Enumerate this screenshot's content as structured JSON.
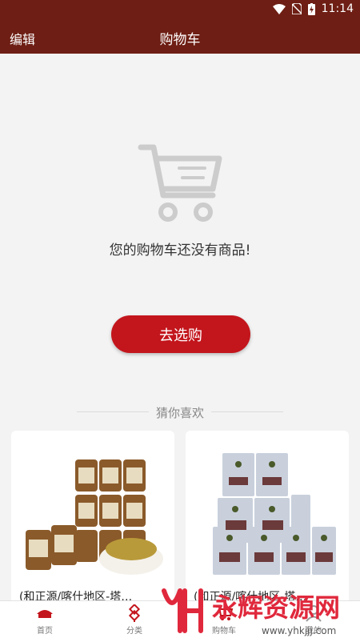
{
  "status": {
    "time": "11:14"
  },
  "header": {
    "edit_label": "编辑",
    "title": "购物车"
  },
  "empty": {
    "message": "您的购物车还没有商品!",
    "go_button": "去选购"
  },
  "recommend": {
    "heading": "猜你喜欢",
    "items": [
      {
        "name": "(和正源/喀什地区-塔…"
      },
      {
        "name": "(和正源/喀什地区-塔…"
      }
    ]
  },
  "tabs": [
    {
      "label": "首页"
    },
    {
      "label": "分类"
    },
    {
      "label": "购物车"
    },
    {
      "label": "我的"
    }
  ],
  "watermark": {
    "text": "永辉资源网",
    "url": "www.yhkjjj.com"
  },
  "colors": {
    "brand": "#6e1e14",
    "accent": "#c3151c"
  }
}
